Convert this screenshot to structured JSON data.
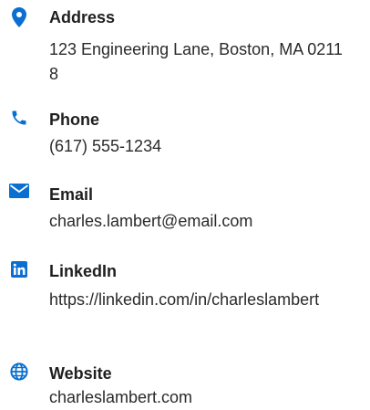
{
  "accent_color": "#0a6fd0",
  "contacts": {
    "address": {
      "icon": "map-marker-icon",
      "label": "Address",
      "value": "123 Engineering Lane, Boston, MA 02118"
    },
    "phone": {
      "icon": "phone-icon",
      "label": "Phone",
      "value": "(617) 555-1234"
    },
    "email": {
      "icon": "envelope-icon",
      "label": "Email",
      "value": "charles.lambert@email.com"
    },
    "linkedin": {
      "icon": "linkedin-icon",
      "label": "LinkedIn",
      "value": "https://linkedin.com/in/charleslambert"
    },
    "website": {
      "icon": "globe-icon",
      "label": "Website",
      "value": "charleslambert.com"
    }
  }
}
